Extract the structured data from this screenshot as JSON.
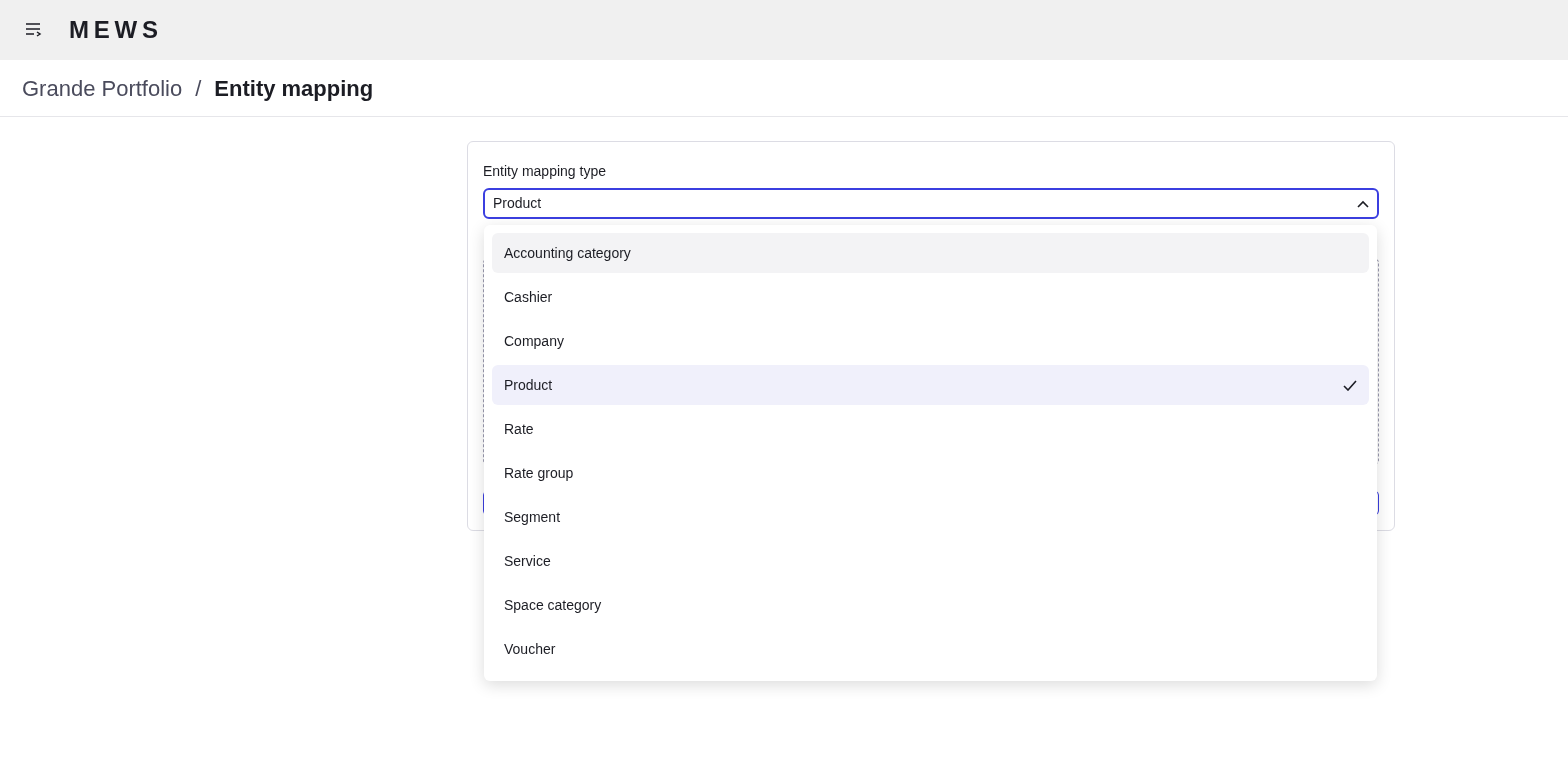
{
  "header": {
    "logo": "MEWS"
  },
  "breadcrumb": {
    "parent": "Grande Portfolio",
    "separator": "/",
    "current": "Entity mapping"
  },
  "form": {
    "label": "Entity mapping type",
    "value": "Product",
    "expanded": true
  },
  "options": [
    {
      "label": "Accounting category",
      "highlighted": true,
      "selected": false
    },
    {
      "label": "Cashier",
      "highlighted": false,
      "selected": false
    },
    {
      "label": "Company",
      "highlighted": false,
      "selected": false
    },
    {
      "label": "Product",
      "highlighted": false,
      "selected": true
    },
    {
      "label": "Rate",
      "highlighted": false,
      "selected": false
    },
    {
      "label": "Rate group",
      "highlighted": false,
      "selected": false
    },
    {
      "label": "Segment",
      "highlighted": false,
      "selected": false
    },
    {
      "label": "Service",
      "highlighted": false,
      "selected": false
    },
    {
      "label": "Space category",
      "highlighted": false,
      "selected": false
    },
    {
      "label": "Voucher",
      "highlighted": false,
      "selected": false
    }
  ]
}
